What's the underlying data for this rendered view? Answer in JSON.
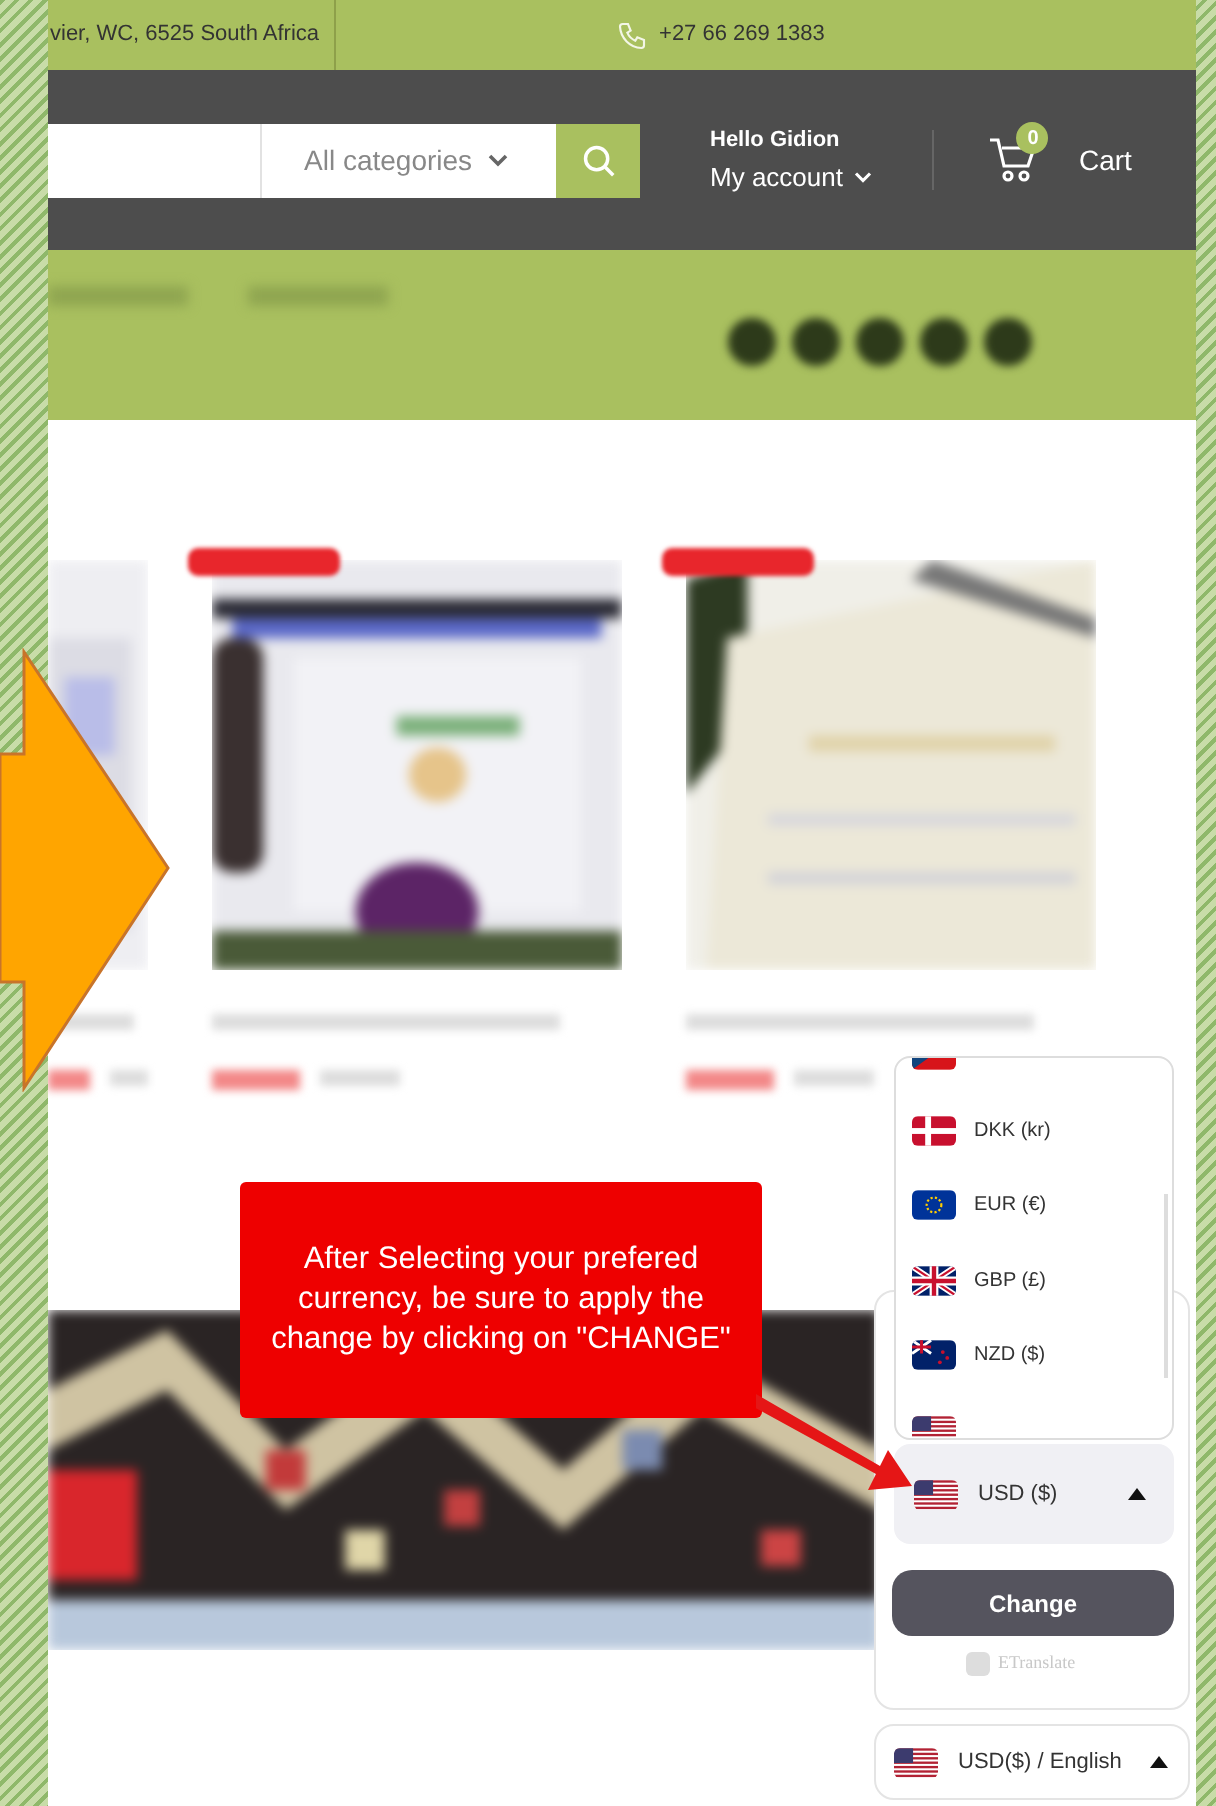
{
  "top_bar": {
    "address": "vier, WC, 6525 South Africa",
    "phone": "+27 66 269 1383"
  },
  "header": {
    "category_select": "All categories",
    "greeting": "Hello Gidion",
    "account": "My account",
    "cart_count": "0",
    "cart": "Cart"
  },
  "products": [
    {
      "kind": "picture",
      "sale": false
    },
    {
      "kind": "picture",
      "sale": true
    },
    {
      "kind": "picture",
      "sale": true
    }
  ],
  "callout": {
    "text": "After Selecting your prefered currency, be sure to apply the change by clicking on \"CHANGE\""
  },
  "currency_widget": {
    "options": [
      {
        "kind": "cz"
      },
      {
        "code": "DKK (kr)",
        "kind": "dk"
      },
      {
        "code": "EUR (€)",
        "kind": "eu"
      },
      {
        "code": "GBP (£)",
        "kind": "gb"
      },
      {
        "code": "NZD ($)",
        "kind": "nz"
      },
      {
        "kind": "us"
      }
    ],
    "current": {
      "label": "USD ($)",
      "kind": "us"
    },
    "button": "Change",
    "powered_by": "ETranslate",
    "switcher": "USD($) / English"
  }
}
